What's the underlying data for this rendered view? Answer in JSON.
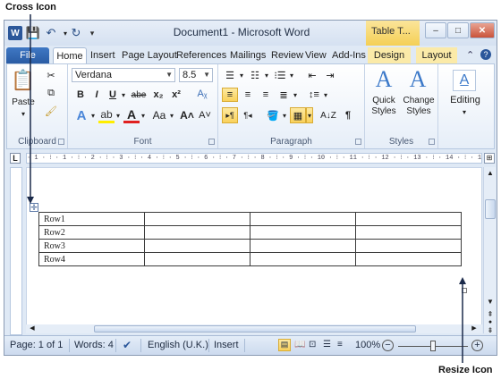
{
  "annotations": {
    "cross_icon": "Cross Icon",
    "resize_icon": "Resize Icon"
  },
  "titlebar": {
    "app_icon": "W",
    "title": "Document1 - Microsoft Word",
    "contextual_group": "Table T...",
    "minimize": "–",
    "maximize": "□",
    "close": "✕"
  },
  "tabs": [
    "File",
    "Home",
    "Insert",
    "Page Layout",
    "References",
    "Mailings",
    "Review",
    "View",
    "Add-Ins",
    "Design",
    "Layout"
  ],
  "ribbon": {
    "clipboard": {
      "label": "Clipboard",
      "paste": "Paste"
    },
    "font": {
      "label": "Font",
      "font_name": "Verdana",
      "font_size": "8.5",
      "bold": "B",
      "italic": "I",
      "underline": "U",
      "strikethrough": "abe",
      "subscript": "x₂",
      "superscript": "x²",
      "grow": "A˄",
      "shrink": "A˅",
      "change_case": "Aa"
    },
    "paragraph": {
      "label": "Paragraph"
    },
    "styles": {
      "label": "Styles",
      "quick_styles_1": "Quick",
      "quick_styles_2": "Styles",
      "change_styles_1": "Change",
      "change_styles_2": "Styles"
    },
    "editing": {
      "label": "Editing"
    }
  },
  "ruler_text": "· 1 · ⁝ · 1 · ⁝ · 2 · ⁝ · 3 · ⁝ · 4 · ⁝ · 5 · ⁝ · 6 · ⁝ · 7 · ⁝ · 8 · ⁝ · 9 · ⁝ · 10 · ⁝ · 11 · ⁝ · 12 · ⁝ · 13 · ⁝ · 14 · ⁝ · 15 · ⁝ · 16 · ⁝ · 17",
  "table": {
    "rows": [
      [
        "Row1",
        "",
        "",
        ""
      ],
      [
        "Row2",
        "",
        "",
        ""
      ],
      [
        "Row3",
        "",
        "",
        ""
      ],
      [
        "Row4",
        "",
        "",
        ""
      ]
    ]
  },
  "statusbar": {
    "page": "Page: 1 of 1",
    "words": "Words: 4",
    "language": "English (U.K.)",
    "mode": "Insert",
    "zoom": "100%"
  },
  "colors": {
    "file_tab": "#2a5ca4",
    "contextual_tab": "#f4cf55",
    "selection": "#f9d15b"
  }
}
